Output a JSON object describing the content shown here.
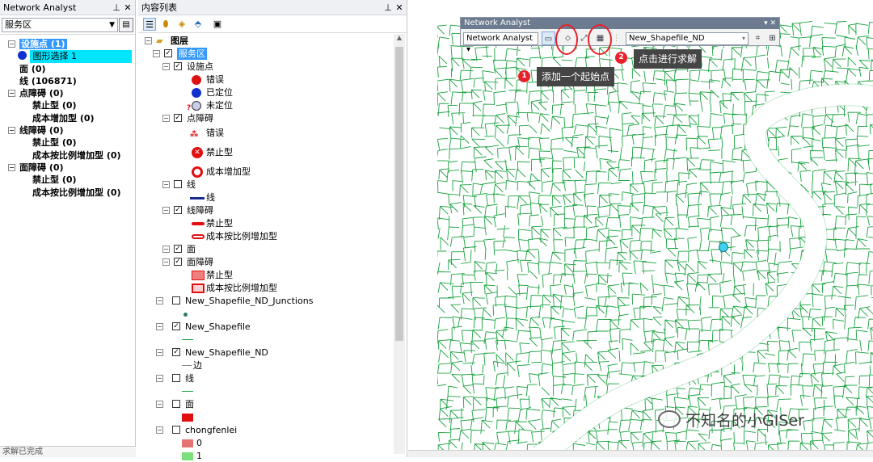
{
  "left_panel": {
    "title": "Network Analyst",
    "pin_icon": "pin-icon",
    "close_label": "✕",
    "layer_combo": "服务区",
    "items": [
      {
        "label": "设施点 (1)",
        "bold": true
      },
      {
        "label": "图形选择 1"
      },
      {
        "label": "面 (0)",
        "bold": true
      },
      {
        "label": "线 (106871)",
        "bold": true
      },
      {
        "label": "点障碍 (0)",
        "bold": true
      },
      {
        "label": "禁止型 (0)",
        "bold": true
      },
      {
        "label": "成本增加型 (0)",
        "bold": true
      },
      {
        "label": "线障碍 (0)",
        "bold": true
      },
      {
        "label": "禁止型 (0)",
        "bold": true
      },
      {
        "label": "成本按比例增加型 (0)",
        "bold": true
      },
      {
        "label": "面障碍 (0)",
        "bold": true
      },
      {
        "label": "禁止型 (0)",
        "bold": true
      },
      {
        "label": "成本按比例增加型 (0)",
        "bold": true
      }
    ],
    "status": "求解已完成"
  },
  "toc": {
    "title": "内容列表",
    "root": "图层",
    "service_area": "服务区",
    "facilities": "设施点",
    "fac_error": "错误",
    "fac_located": "已定位",
    "fac_unlocated": "未定位",
    "point_barriers": "点障碍",
    "pb_error": "错误",
    "pb_restriction": "禁止型",
    "pb_cost": "成本增加型",
    "lines": "线",
    "lines_sym": "线",
    "line_barriers": "线障碍",
    "lb_restriction": "禁止型",
    "lb_scaled": "成本按比例增加型",
    "polygons": "面",
    "polygon_barriers": "面障碍",
    "polyb_restriction": "禁止型",
    "polyb_scaled": "成本按比例增加型",
    "junctions": "New_Shapefile_ND_Junctions",
    "shapefile": "New_Shapefile",
    "nd": "New_Shapefile_ND",
    "nd_edge": "边",
    "line_layer": "线",
    "polygon_layer": "面",
    "chongfenlei": "chongfenlei",
    "cls0": "0",
    "cls1": "1"
  },
  "na_toolbar": {
    "title": "Network Analyst",
    "menu_label": "Network Analyst ▾",
    "network_combo": "New_Shapefile_ND"
  },
  "annotations": {
    "badge1": "1",
    "callout1": "添加一个起始点",
    "badge2": "2",
    "callout2": "点击进行求解"
  },
  "watermark": "不知名的小GISer",
  "colors": {
    "network": "#19a23f",
    "selection": "#3399ff",
    "highlight": "#00e5ff",
    "annotation_red": "#e8202a",
    "facility_point": "#3fd3f0"
  }
}
